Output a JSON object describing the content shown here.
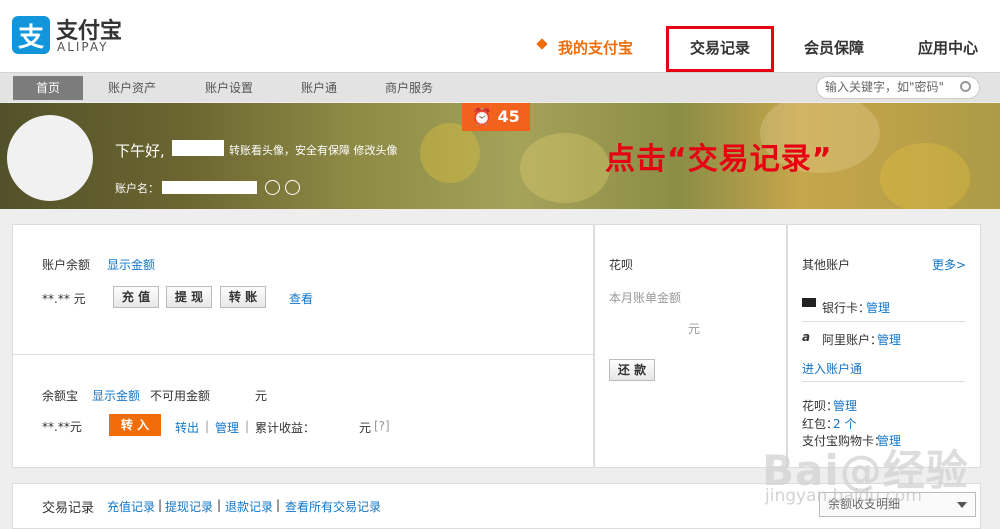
{
  "logo": {
    "glyph": "支",
    "cn": "支付宝",
    "en": "ALIPAY"
  },
  "topnav": [
    {
      "label": "我的支付宝"
    },
    {
      "label": "交易记录"
    },
    {
      "label": "会员保障"
    },
    {
      "label": "应用中心"
    }
  ],
  "subnav": [
    {
      "label": "首页"
    },
    {
      "label": "账户资产"
    },
    {
      "label": "账户设置"
    },
    {
      "label": "账户通"
    },
    {
      "label": "商户服务"
    }
  ],
  "search": {
    "placeholder": "输入关键字，如\"密码\""
  },
  "banner": {
    "greeting": "下午好,",
    "greeting_rest": "转账看头像，安全有保障 修改头像",
    "account_label": "账户名：",
    "badge": "45",
    "annotation": "点击“交易记录”"
  },
  "balance": {
    "title": "账户余额",
    "show": "显示金额",
    "amount": "**.** 元",
    "buttons": [
      "充 值",
      "提 现",
      "转 账"
    ],
    "view": "查看"
  },
  "yuebao": {
    "title": "余额宝",
    "show": "显示金额",
    "unavailable": "不可用金额",
    "unit": "元",
    "amount": "**.**元",
    "in": "转 入",
    "out": "转出",
    "manage": "管理",
    "yield": "累计收益：",
    "yield_unit": "元",
    "help": "[?]"
  },
  "huabei": {
    "title": "花呗",
    "subtitle": "本月账单金额",
    "unit": "元",
    "repay": "还 款"
  },
  "other": {
    "title": "其他账户",
    "more": "更多>",
    "bank_label": "银行卡：",
    "bank_link": "管理",
    "ali_label": "阿里账户：",
    "ali_link": "管理",
    "enter": "进入账户通",
    "huabei_label": "花呗：",
    "huabei_link": "管理",
    "redpacket_label": "红包：",
    "redpacket_value": "2 个",
    "voucher_label": "支付宝购物卡：",
    "voucher_link": "管理"
  },
  "records": {
    "title": "交易记录",
    "links": [
      "充值记录",
      "提现记录",
      "退款记录",
      "查看所有交易记录"
    ],
    "select": "余额收支明细"
  },
  "watermark": {
    "main": "Bai@经验",
    "sub": "jingyan.baidu.com"
  }
}
